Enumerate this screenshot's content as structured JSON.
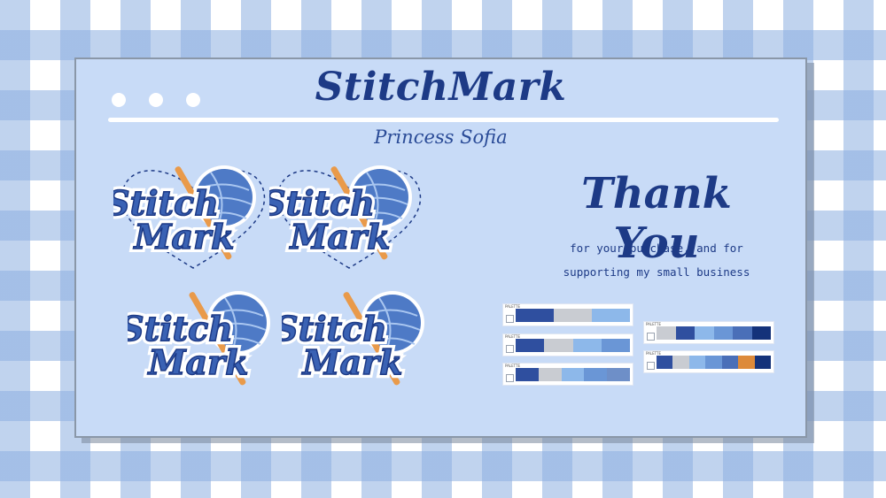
{
  "brand": {
    "title": "StitchMark",
    "subtitle": "Princess Sofia"
  },
  "stickers": [
    {
      "line1": "Stitch",
      "line2": "Mark",
      "heart_outline": true
    },
    {
      "line1": "Stitch",
      "line2": "Mark",
      "heart_outline": true
    },
    {
      "line1": "Stitch",
      "line2": "Mark",
      "heart_outline": false
    },
    {
      "line1": "Stitch",
      "line2": "Mark",
      "heart_outline": false
    }
  ],
  "thank_you": {
    "heading": "Thank You",
    "line1": "for your purchase, and for",
    "line2": "supporting my small business"
  },
  "palettes": [
    {
      "label": "PALETTE",
      "colors": [
        "#2f4f9f",
        "#c9ccd2",
        "#8db8ea"
      ]
    },
    {
      "label": "PALETTE",
      "colors": [
        "#2f4f9f",
        "#c9ccd2",
        "#8db8ea",
        "#6a96d6"
      ]
    },
    {
      "label": "PALETTE",
      "colors": [
        "#2f4f9f",
        "#c9ccd2",
        "#8db8ea",
        "#6a96d6",
        "#6e8fc8"
      ]
    },
    {
      "label": "PALETTE",
      "colors": [
        "#c9ccd2",
        "#2f4f9f",
        "#8db8ea",
        "#6a96d6",
        "#4a6fb8",
        "#14327a"
      ]
    },
    {
      "label": "PALETTE",
      "colors": [
        "#2f4f9f",
        "#c9ccd2",
        "#8db8ea",
        "#6a96d6",
        "#4a6fb8",
        "#dd8a3a",
        "#14327a"
      ]
    }
  ],
  "colors": {
    "navy": "#1d3a86",
    "card": "#c8dbf7",
    "gingham": "#8cafe1"
  }
}
